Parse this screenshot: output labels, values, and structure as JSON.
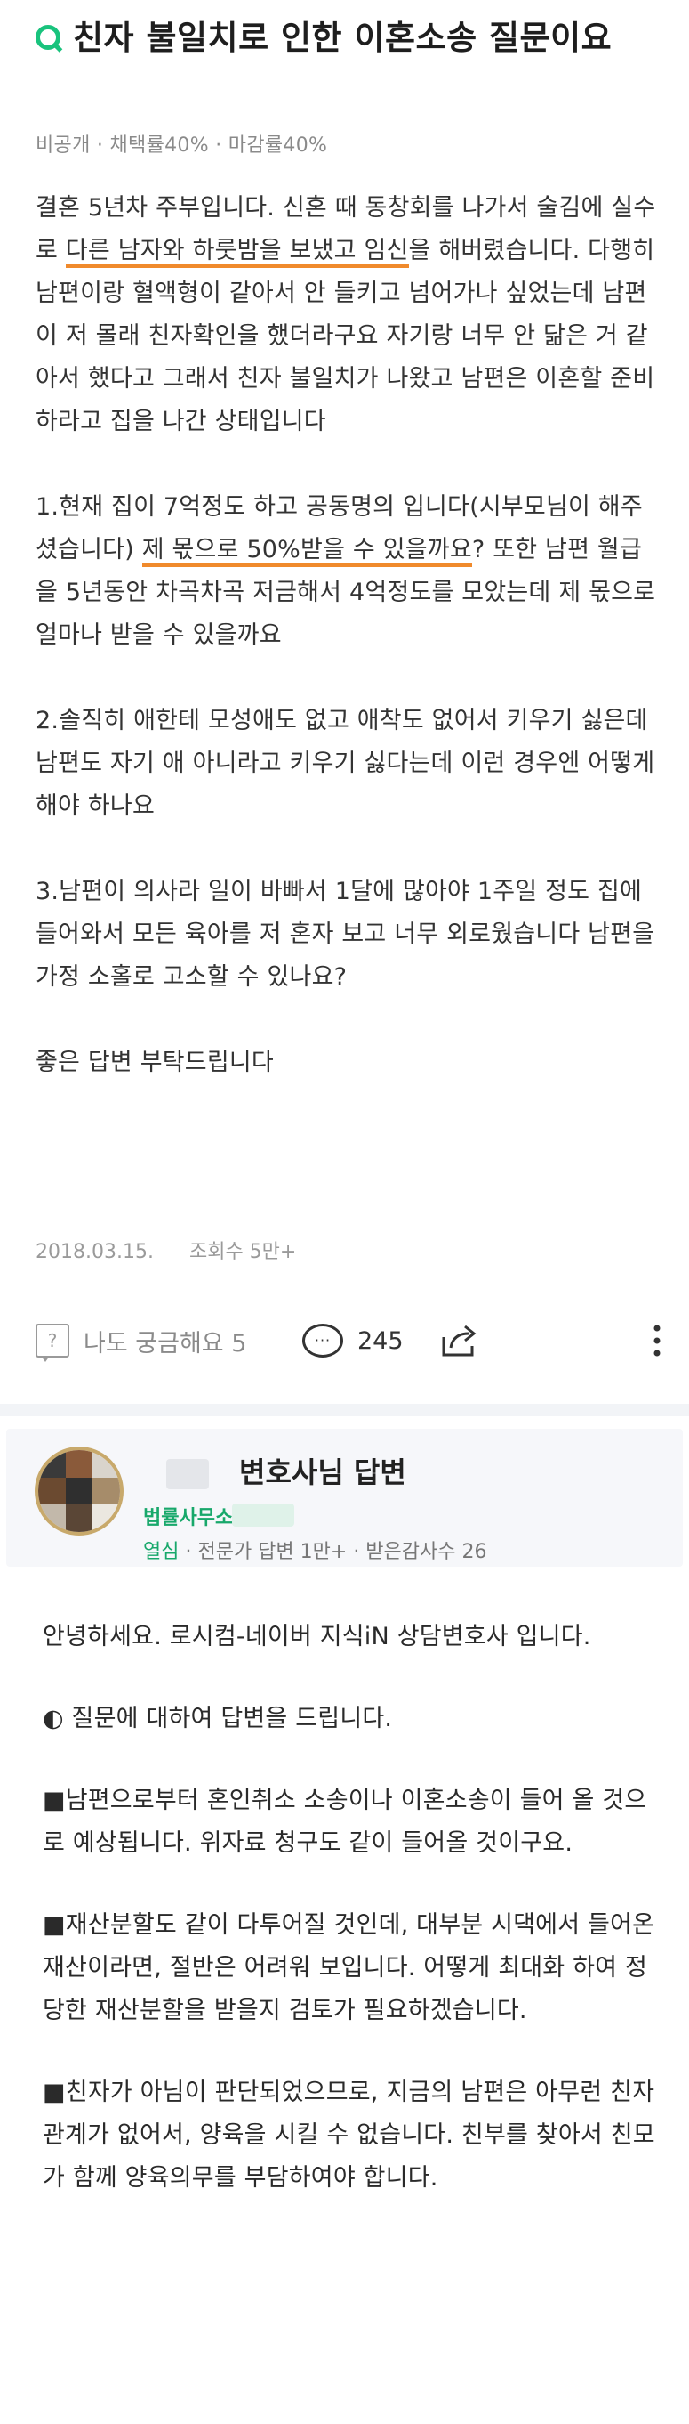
{
  "question": {
    "title": "친자 불일치로 인한 이혼소송 질문이요",
    "meta": "비공개 · 채택률40% · 마감률40%",
    "body": {
      "p1": [
        {
          "text": "결혼 5년차 주부입니다. 신혼 때 동창회를 나가서 술김에 실수로 ",
          "u": false
        },
        {
          "text": "다른 남자와 하룻밤을 보냈고 임신",
          "u": true
        },
        {
          "text": "을 해버렸습니다. 다행히 남편이랑 혈액형이 같아서 안 들키고 넘어가나 싶었는데 남편이 저 몰래 친자확인을 했더라구요 자기랑 너무 안 닮은 거 같아서 했다고 그래서 친자 불일치가 나왔고 남편은 이혼할 준비 하라고 집을 나간 상태입니다",
          "u": false
        }
      ],
      "p2": [
        {
          "text": "1.현재 집이 7억정도 하고 공동명의 입니다(시부모님이 해주셨습니다) ",
          "u": false
        },
        {
          "text": "제 몫으로 50%받을 수 있을까요",
          "u": true
        },
        {
          "text": "? 또한 남편 월급을 5년동안 차곡차곡 저금해서 4억정도를 모았는데 제 몫으로 얼마나 받을 수 있을까요",
          "u": false
        }
      ],
      "p3": "2.솔직히 애한테 모성애도 없고 애착도 없어서 키우기 싫은데 남편도 자기 애 아니라고 키우기 싫다는데 이런 경우엔 어떻게 해야 하나요",
      "p4": "3.남편이 의사라 일이 바빠서 1달에 많아야 1주일 정도 집에 들어와서 모든 육아를 저 혼자 보고 너무 외로웠습니다 남편을 가정 소홀로 고소할 수 있나요?",
      "p5": "좋은 답변 부탁드립니다"
    },
    "date": "2018.03.15.",
    "views": "조회수 5만+"
  },
  "actions": {
    "curious_label": "나도 궁금해요 5",
    "comment_count": "245",
    "icons": [
      "question-icon",
      "comment-icon",
      "share-icon",
      "more-icon"
    ]
  },
  "answer": {
    "header": {
      "title": "변호사님 답변",
      "firm": "법률사무소",
      "stats_lead": "열심",
      "stats_rest": " · 전문가 답변 1만+ · 받은감사수 26"
    },
    "paragraphs": [
      "안녕하세요. 로시컴-네이버 지식iN 상담변호사 입니다.",
      "◐ 질문에 대하여 답변을 드립니다.",
      "■남편으로부터 혼인취소 소송이나 이혼소송이 들어 올 것으로 예상됩니다. 위자료 청구도 같이 들어올 것이구요.",
      "■재산분할도 같이 다투어질 것인데, 대부분 시댁에서 들어온 재산이라면, 절반은 어려워 보입니다. 어떻게 최대화 하여 정당한 재산분할을 받을지 검토가 필요하겠습니다.",
      "■친자가 아님이 판단되었으므로, 지금의 남편은 아무런 친자관계가 없어서, 양육을 시킬 수 없습니다. 친부를 찾아서 친모가 함께 양육의무를 부담하여야 합니다."
    ]
  },
  "colors": {
    "brand_green": "#19c37d",
    "highlight_underline": "#f08a2c"
  }
}
